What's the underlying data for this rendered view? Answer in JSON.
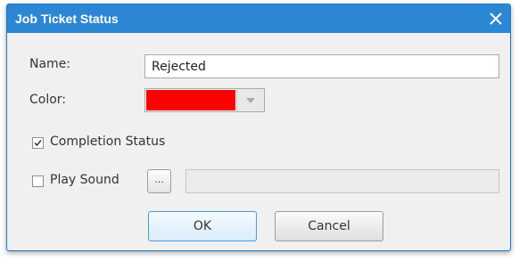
{
  "dialog": {
    "title": "Job Ticket Status",
    "title_bar_color": "#2b87d3",
    "close_icon": "close-icon"
  },
  "form": {
    "name_label": "Name:",
    "name_value": "Rejected",
    "color_label": "Color:",
    "color_value": "#ff0000",
    "dropdown_icon": "chevron-down-icon",
    "completion_status_label": "Completion Status",
    "completion_status_checked": true,
    "play_sound_label": "Play Sound",
    "play_sound_checked": false,
    "browse_label": "...",
    "sound_path_value": ""
  },
  "buttons": {
    "ok_label": "OK",
    "cancel_label": "Cancel"
  }
}
